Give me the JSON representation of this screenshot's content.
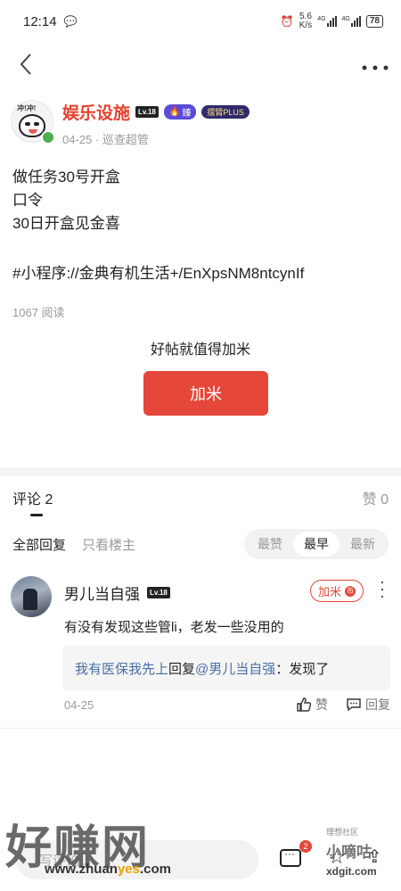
{
  "status": {
    "time": "12:14",
    "speed": "5.6",
    "speed_unit": "K/s",
    "net1": "4G",
    "net2": "4G",
    "battery": "78"
  },
  "post": {
    "author_name": "娱乐设施",
    "level": "Lv.18",
    "badge_flame": "臻",
    "badge_plus": "摆臂PLUS",
    "date": "04-25",
    "role": "巡查超管",
    "lines": [
      "做任务30号开盒",
      "口令",
      "30日开盒见金喜",
      "#小程序://金典有机生活+/EnXpsNM8ntcynIf"
    ],
    "reads": "1067 阅读",
    "worth_text": "好帖就值得加米",
    "jiami_label": "加米"
  },
  "comments_section": {
    "tab_label": "评论 2",
    "like_label": "赞 0",
    "filter_all": "全部回复",
    "filter_owner": "只看楼主",
    "sort_options": [
      "最赞",
      "最早",
      "最新"
    ],
    "sort_active": "最早"
  },
  "comment": {
    "name": "男儿当自强",
    "level": "Lv.18",
    "jiami_label": "加米",
    "coin": "币",
    "text": "有没有发现这些管li，老发一些没用的",
    "reply_from": "我有医保我先上",
    "reply_word": "回复",
    "reply_to": "@男儿当自强",
    "reply_text": "：发现了",
    "date": "04-25",
    "like_label": "赞",
    "reply_label": "回复"
  },
  "bottom": {
    "input_placeholder": "写评论...",
    "comment_badge": "2"
  },
  "watermark": {
    "left_big": "好赚网",
    "left_url_a": "www.zhuan",
    "left_url_b": "yes",
    "left_url_c": ".com",
    "right_tag": "理想社区",
    "right_logo": "小嘀咕",
    "right_url": "xdgit.com"
  }
}
